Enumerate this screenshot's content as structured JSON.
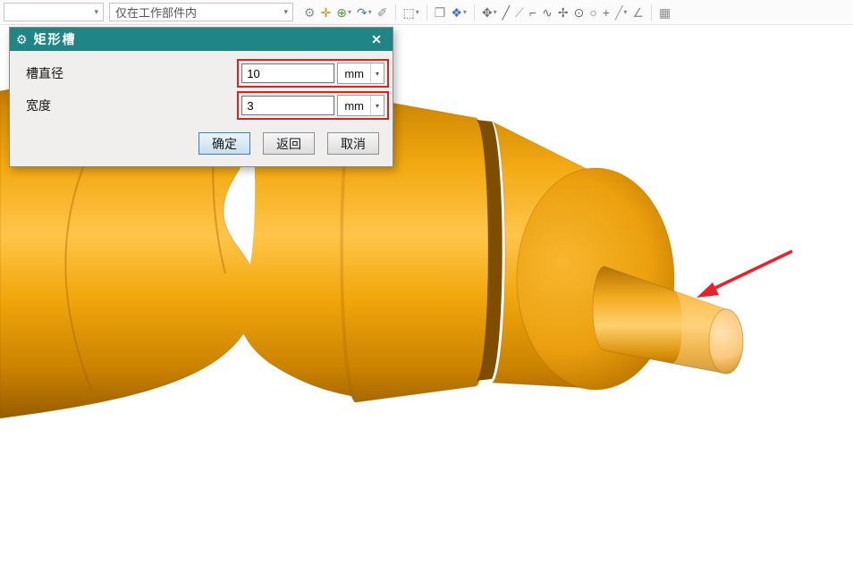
{
  "toolbar": {
    "filter_combo_value": "",
    "selection_scope": "仅在工作部件内",
    "dropdown_arrow": "▾",
    "icons": [
      {
        "name": "gears-icon",
        "glyph": "⚙",
        "color": "#8f8f8f"
      },
      {
        "name": "smart-point-icon",
        "glyph": "✛",
        "color": "#c98f12"
      },
      {
        "name": "snap-point-icon",
        "glyph": "⊕",
        "color": "#4f9b3a",
        "dropdown": true
      },
      {
        "name": "undo-curve-icon",
        "glyph": "↷",
        "color": "#4a7fc1",
        "dropdown": true
      },
      {
        "name": "measure-icon",
        "glyph": "✐",
        "color": "#8f8f8f"
      },
      {
        "separator": true
      },
      {
        "name": "rectangle-select-icon",
        "glyph": "⬚",
        "color": "#6f6f6f",
        "dropdown": true
      },
      {
        "separator": true
      },
      {
        "name": "shaded-cube-icon",
        "glyph": "❒",
        "color": "#8f8f8f"
      },
      {
        "name": "view-cube-icon",
        "glyph": "❖",
        "color": "#3f74c9",
        "dropdown": true
      },
      {
        "separator": true
      },
      {
        "name": "pan-icon",
        "glyph": "✥",
        "color": "#6f6f6f",
        "dropdown": true
      },
      {
        "name": "line-icon",
        "glyph": "╱",
        "color": "#6f6f6f"
      },
      {
        "name": "thin-line-icon",
        "glyph": "⟋",
        "color": "#9f9f9f"
      },
      {
        "name": "arc-icon",
        "glyph": "⌐",
        "color": "#6f6f6f"
      },
      {
        "name": "spline-icon",
        "glyph": "∿",
        "color": "#6f6f6f"
      },
      {
        "name": "point-icon",
        "glyph": "✢",
        "color": "#6f6f6f"
      },
      {
        "name": "circle-center-icon",
        "glyph": "⊙",
        "color": "#6f6f6f"
      },
      {
        "name": "circle-icon",
        "glyph": "○",
        "color": "#6f6f6f"
      },
      {
        "name": "plus-icon",
        "glyph": "+",
        "color": "#6f6f6f"
      },
      {
        "name": "slash-icon",
        "glyph": "╱",
        "color": "#9f9f9f",
        "dropdown": true
      },
      {
        "name": "angle-icon",
        "glyph": "∠",
        "color": "#8f8f8f"
      },
      {
        "separator": true
      },
      {
        "name": "grid-icon",
        "glyph": "▦",
        "color": "#8f8f8f"
      }
    ]
  },
  "dialog": {
    "gear_icon": "⚙",
    "title": "矩形槽",
    "close_icon": "✕",
    "fields": [
      {
        "label": "槽直径",
        "value": "10",
        "unit": "mm"
      },
      {
        "label": "宽度",
        "value": "3",
        "unit": "mm"
      }
    ],
    "buttons": [
      {
        "label": "确定"
      },
      {
        "label": "返回"
      },
      {
        "label": "取消"
      }
    ]
  },
  "viewport": {
    "model": "stepped-shaft-3d-model",
    "annotation": "red-arrow"
  },
  "colors": {
    "dialog_titlebar": "#1f8585",
    "field_highlight_box": "#d32525",
    "primary_button_border": "#3c7fb1",
    "shaft_main": "#f5a70a",
    "shaft_highlight": "#ffc54a",
    "shaft_shadow": "#9a5e00",
    "arrow_red": "#e8212b"
  }
}
